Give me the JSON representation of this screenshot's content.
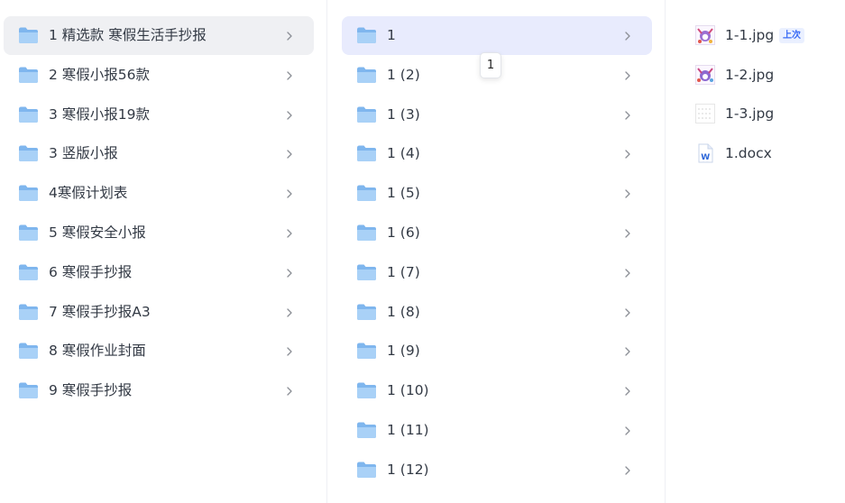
{
  "column1": {
    "items": [
      {
        "label": "1 精选款 寒假生活手抄报",
        "selected": true
      },
      {
        "label": "2 寒假小报56款"
      },
      {
        "label": "3 寒假小报19款"
      },
      {
        "label": "3 竖版小报"
      },
      {
        "label": "4寒假计划表"
      },
      {
        "label": "5 寒假安全小报"
      },
      {
        "label": "6 寒假手抄报"
      },
      {
        "label": "7 寒假手抄报A3"
      },
      {
        "label": "8 寒假作业封面"
      },
      {
        "label": "9 寒假手抄报"
      }
    ]
  },
  "column2": {
    "items": [
      {
        "label": "1",
        "selected": true
      },
      {
        "label": "1 (2)"
      },
      {
        "label": "1 (3)"
      },
      {
        "label": "1 (4)"
      },
      {
        "label": "1 (5)"
      },
      {
        "label": "1 (6)"
      },
      {
        "label": "1 (7)"
      },
      {
        "label": "1 (8)"
      },
      {
        "label": "1 (9)"
      },
      {
        "label": "1 (10)"
      },
      {
        "label": "1 (11)"
      },
      {
        "label": "1 (12)"
      }
    ],
    "tooltip": "1"
  },
  "column3": {
    "files": [
      {
        "label": "1-1.jpg",
        "icon": "image-thumbnail-icon",
        "badge": "上次"
      },
      {
        "label": "1-2.jpg",
        "icon": "image-thumbnail-icon"
      },
      {
        "label": "1-3.jpg",
        "icon": "image-thumbnail-icon"
      },
      {
        "label": "1.docx",
        "icon": "word-doc-icon"
      }
    ]
  },
  "colors": {
    "folder": "#7fb6ee",
    "selected_left": "#eff0f3",
    "selected_mid": "#e8ebfd",
    "badge_text": "#3b6cf6",
    "word_blue": "#2b66d8"
  }
}
